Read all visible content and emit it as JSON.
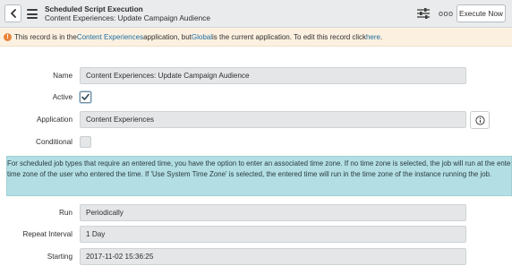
{
  "header": {
    "title": "Scheduled Script Execution",
    "subtitle": "Content Experiences: Update Campaign Audience",
    "more_label": "ooo",
    "execute_label": "Execute Now"
  },
  "warning": {
    "icon": "!",
    "part1": "This record is in the ",
    "app_link": "Content Experiences",
    "part2": " application, but ",
    "current_app": "Global",
    "part3": " is the current application. To edit this record click ",
    "here_link": "here",
    "part4": "."
  },
  "form": {
    "name_label": "Name",
    "name_value": "Content Experiences: Update Campaign Audience",
    "active_label": "Active",
    "active_checked": true,
    "application_label": "Application",
    "application_value": "Content Experiences",
    "conditional_label": "Conditional",
    "conditional_checked": false,
    "info_line1": "For scheduled job types that require an entered time, you have the option to enter an associated time zone. If no time zone is selected, the job will run at the entered time in the",
    "info_line2": "time zone of the user who entered the time. If 'Use System Time Zone' is selected, the entered time will run in the time zone of the instance running the job.",
    "run_label": "Run",
    "run_value": "Periodically",
    "repeat_label": "Repeat Interval",
    "repeat_value": "1 Day",
    "starting_label": "Starting",
    "starting_value": "2017-11-02 15:36:25"
  },
  "colors": {
    "header_bg": "#e9ebec",
    "warning_bg": "#fcf1e1",
    "link": "#1d6c9e",
    "info_bg": "#b3dfe4",
    "field_bg": "#e4e6e7"
  }
}
